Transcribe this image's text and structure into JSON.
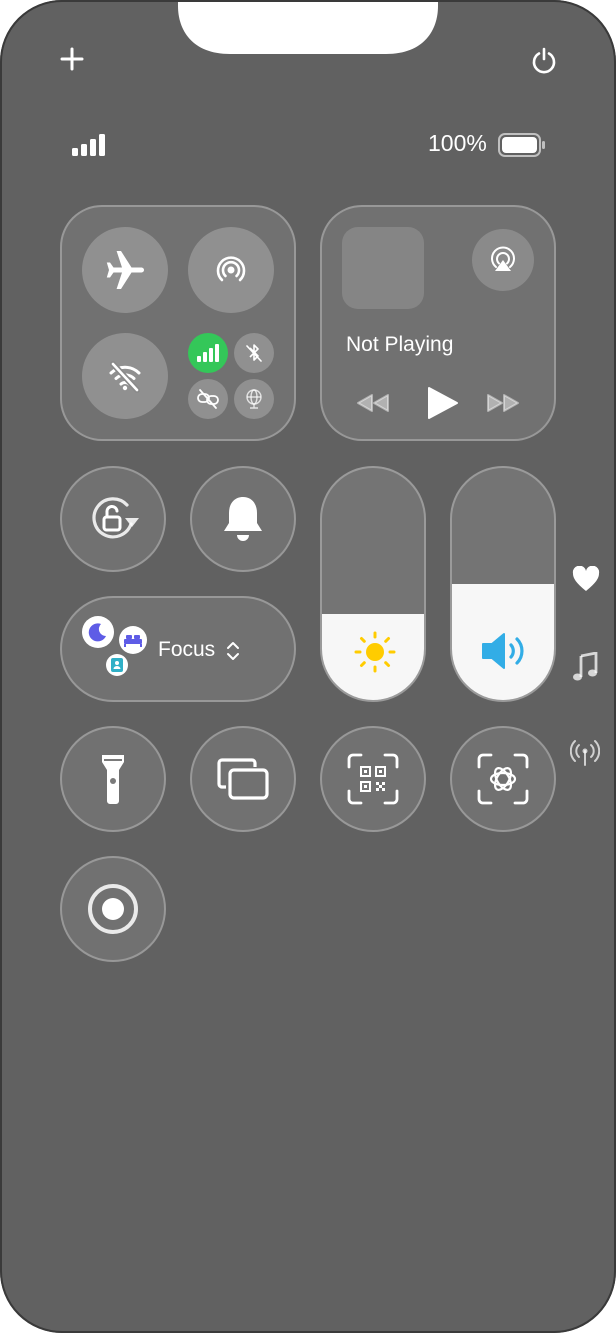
{
  "status_bar": {
    "battery_percent": "100%",
    "battery_level": 1.0,
    "signal_bars": 4
  },
  "top_controls": {
    "add_icon": "plus-icon",
    "power_icon": "power-icon"
  },
  "connectivity": {
    "airplane_mode": false,
    "airdrop": false,
    "wifi": false,
    "cellular": true,
    "bluetooth": false,
    "vpn": false,
    "hotspot": false,
    "accent_color": "#34c759"
  },
  "now_playing": {
    "title": "Not Playing"
  },
  "focus": {
    "label": "Focus",
    "color": "#5e5ce6"
  },
  "sliders": {
    "brightness": 0.37,
    "volume": 0.5,
    "brightness_icon_color": "#ffcc00",
    "volume_icon_color": "#32ade6"
  },
  "side_pages": {
    "icons": [
      "heart-icon",
      "music-note-icon",
      "antenna-icon"
    ]
  }
}
